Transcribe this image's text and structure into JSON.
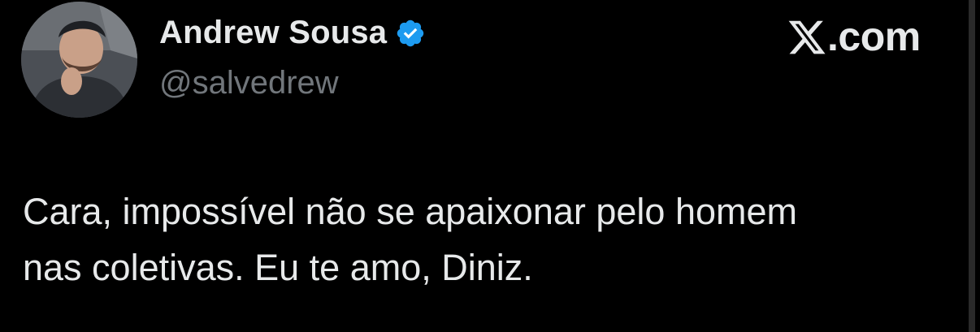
{
  "author": {
    "display_name": "Andrew Sousa",
    "handle": "@salvedrew",
    "verified": true,
    "verified_icon": "verified-badge-icon",
    "verified_color": "#1d9bf0"
  },
  "brand": {
    "icon": "x-logo-icon",
    "suffix": ".com"
  },
  "tweet": {
    "lines": [
      "Cara, impossível não se apaixonar pelo homem",
      "nas coletivas. Eu te amo, Diniz."
    ]
  },
  "colors": {
    "background": "#000000",
    "text": "#e7e9ea",
    "muted": "#71767b"
  }
}
